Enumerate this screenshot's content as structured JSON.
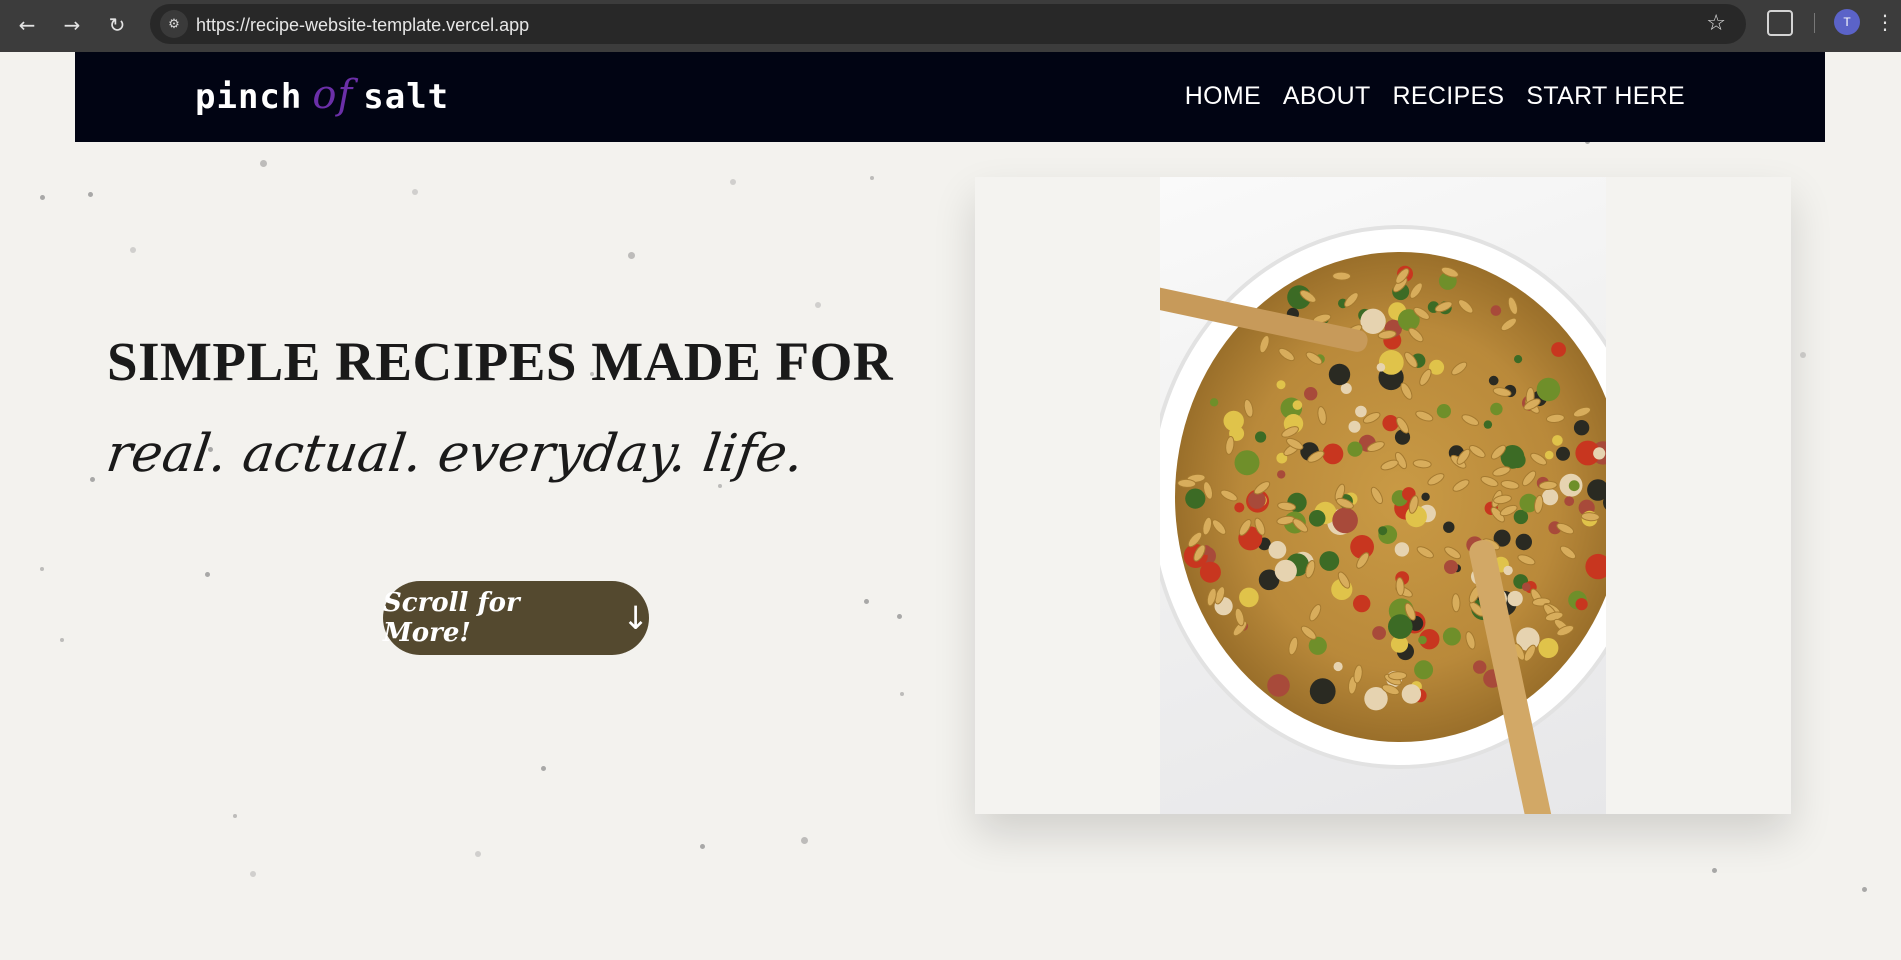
{
  "browser": {
    "url": "https://recipe-website-template.vercel.app",
    "profile_initial": "T",
    "icons": {
      "back": "arrow-left-icon",
      "forward": "arrow-right-icon",
      "reload": "reload-icon",
      "site_info": "tune-icon",
      "bookmark": "star-icon",
      "extensions": "puzzle-icon",
      "menu": "more-vert-icon"
    }
  },
  "site": {
    "logo": {
      "part1": "pinch",
      "part2": "of",
      "part3": "salt"
    },
    "nav": [
      "HOME",
      "ABOUT",
      "RECIPES",
      "START HERE"
    ]
  },
  "hero": {
    "title": "SIMPLE RECIPES MADE FOR",
    "script_line": "real. actual. everyday. life.",
    "button_label": "Scroll for More!",
    "button_arrow": "↓",
    "image_alt": "bowl of pasta salad with wooden spoons"
  },
  "colors": {
    "page_bg": "#f3f2ee",
    "header_bg": "#010413",
    "logo_accent": "#6b2fa8",
    "button_bg": "#54492f"
  }
}
